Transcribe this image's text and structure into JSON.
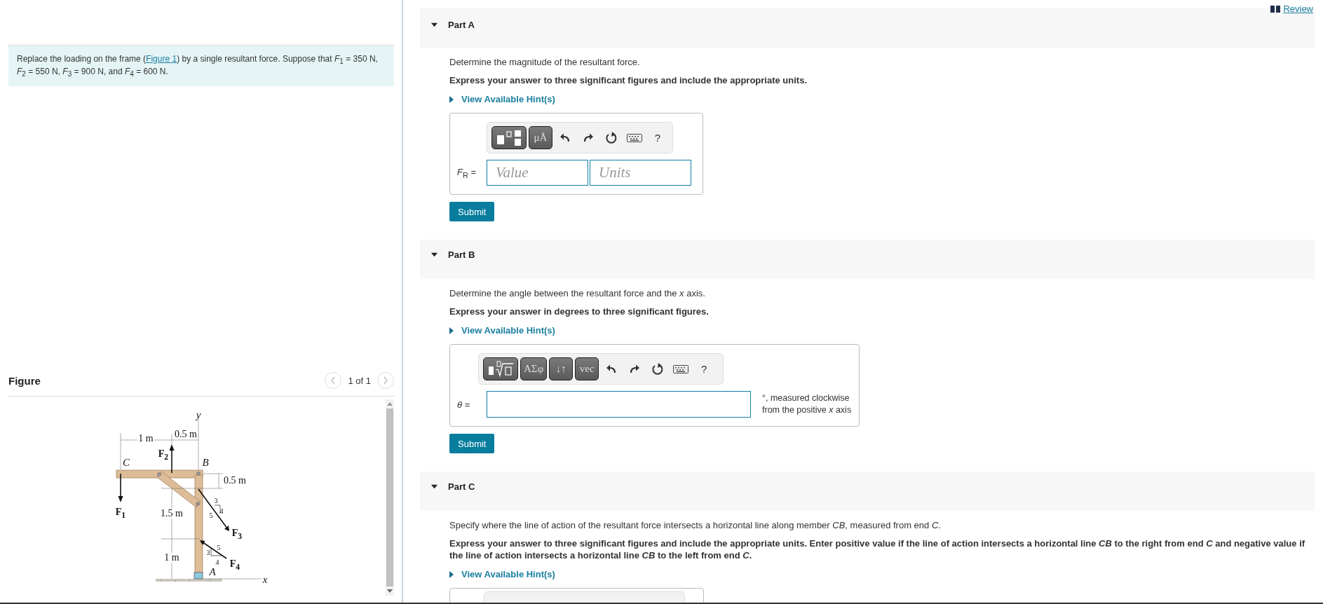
{
  "review_link": "Review",
  "problem": {
    "text_before": "Replace the loading on the frame (",
    "link": "Figure 1",
    "text_after": ") by a single resultant force. Suppose that *F*$_{1}$ = 350 N, *F*$_{2}$ = 550 N, *F*$_{3}$ = 900 N, and *F*$_{4}$ = 600 N."
  },
  "figure": {
    "title": "Figure",
    "pager": "1 of 1",
    "labels": [
      {
        "text": "y",
        "kind": "italic"
      },
      {
        "text": "1 m",
        "kind": "plain"
      },
      {
        "text": "0.5 m",
        "kind": "plain"
      },
      {
        "text": "F$_{2}$",
        "kind": "force"
      },
      {
        "text": "C",
        "kind": "italic"
      },
      {
        "text": "B",
        "kind": "italic"
      },
      {
        "text": "0.5 m",
        "kind": "plain"
      },
      {
        "text": "F$_{1}$",
        "kind": "force"
      },
      {
        "text": "1.5 m",
        "kind": "plain"
      },
      {
        "text": "3",
        "kind": "small"
      },
      {
        "text": "4",
        "kind": "small"
      },
      {
        "text": "5",
        "kind": "small"
      },
      {
        "text": "F$_{3}$",
        "kind": "force"
      },
      {
        "text": "1 m",
        "kind": "plain"
      },
      {
        "text": "3",
        "kind": "small"
      },
      {
        "text": "5",
        "kind": "small"
      },
      {
        "text": "4",
        "kind": "small"
      },
      {
        "text": "F$_{4}$",
        "kind": "force"
      },
      {
        "text": "A",
        "kind": "italic"
      },
      {
        "text": "x",
        "kind": "italic"
      }
    ]
  },
  "parts": [
    {
      "title": "Part A",
      "expanded": true,
      "prompt": "Determine the magnitude of the resultant force.",
      "instruction": "Express your answer to three significant figures and include the appropriate units.",
      "hint": "View Available Hint(s)",
      "answer": {
        "kind": "value_units",
        "label": "*F*$_{R}$ =",
        "value_placeholder": "Value",
        "units_placeholder": "Units",
        "toolbar": [
          {
            "kind": "template"
          },
          {
            "kind": "text",
            "label": "μÅ"
          },
          {
            "kind": "undo"
          },
          {
            "kind": "redo"
          },
          {
            "kind": "reset"
          },
          {
            "kind": "keyboard"
          },
          {
            "kind": "help",
            "label": "?"
          }
        ]
      },
      "submit": "Submit"
    },
    {
      "title": "Part B",
      "expanded": true,
      "prompt": "Determine the angle between the resultant force and the *x* axis.",
      "instruction": "Express your answer in degrees to three significant figures.",
      "hint": "View Available Hint(s)",
      "answer": {
        "kind": "single",
        "label": "*θ* =",
        "unit": "°, measured clockwise from the positive *x* axis",
        "toolbar": [
          {
            "kind": "root"
          },
          {
            "kind": "text",
            "label": "ΑΣφ"
          },
          {
            "kind": "text",
            "label": "↓↑"
          },
          {
            "kind": "text",
            "label": "vec"
          },
          {
            "kind": "undo"
          },
          {
            "kind": "redo"
          },
          {
            "kind": "reset"
          },
          {
            "kind": "keyboard"
          },
          {
            "kind": "help",
            "label": "?"
          }
        ]
      },
      "submit": "Submit"
    },
    {
      "title": "Part C",
      "expanded": true,
      "prompt": "Specify where the line of action of the resultant force intersects a horizontal line along member *CB*, measured from end *C*.",
      "instruction": "Express your answer to three significant figures and include the appropriate units. Enter positive value if the line of action intersects a horizontal line *CB* to the right from end *C* and negative value if the line of action intersects a horizontal line *CB* to the left from end *C*.",
      "hint": "View Available Hint(s)",
      "answer": {
        "kind": "partial"
      }
    }
  ]
}
